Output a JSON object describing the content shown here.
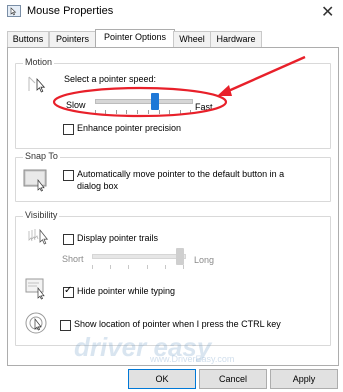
{
  "window": {
    "title": "Mouse Properties",
    "close_glyph": "✕"
  },
  "tabs": [
    {
      "label": "Buttons",
      "active": false
    },
    {
      "label": "Pointers",
      "active": false
    },
    {
      "label": "Pointer Options",
      "active": true
    },
    {
      "label": "Wheel",
      "active": false
    },
    {
      "label": "Hardware",
      "active": false
    }
  ],
  "motion": {
    "legend": "Motion",
    "speed_label": "Select a pointer speed:",
    "slow_label": "Slow",
    "fast_label": "Fast",
    "speed_value": 0.62,
    "precision_label": "Enhance pointer precision",
    "precision_checked": false,
    "icon": "pointer-speed-icon"
  },
  "snap_to": {
    "legend": "Snap To",
    "checkbox_label": "Automatically move pointer to the default button in a dialog box",
    "checkbox_label_line1": "Automatically move pointer to the default button in a",
    "checkbox_label_line2": "dialog box",
    "checked": false,
    "icon": "snap-to-icon"
  },
  "visibility": {
    "legend": "Visibility",
    "trails_label": "Display pointer trails",
    "trails_checked": false,
    "short_label": "Short",
    "long_label": "Long",
    "trail_value": 1.0,
    "hide_label": "Hide pointer while typing",
    "hide_checked": true,
    "show_location_label": "Show location of pointer when I press the CTRL key",
    "show_location_checked": false,
    "icons": [
      "pointer-trails-icon",
      "hide-pointer-icon",
      "show-location-icon"
    ]
  },
  "footer": {
    "ok_label": "OK",
    "cancel_label": "Cancel",
    "apply_label": "Apply"
  },
  "watermark": {
    "brand": "driver easy",
    "url": "www.DriverEasy.com"
  },
  "colors": {
    "accent": "#1e78d7",
    "highlight": "#e8202a"
  }
}
